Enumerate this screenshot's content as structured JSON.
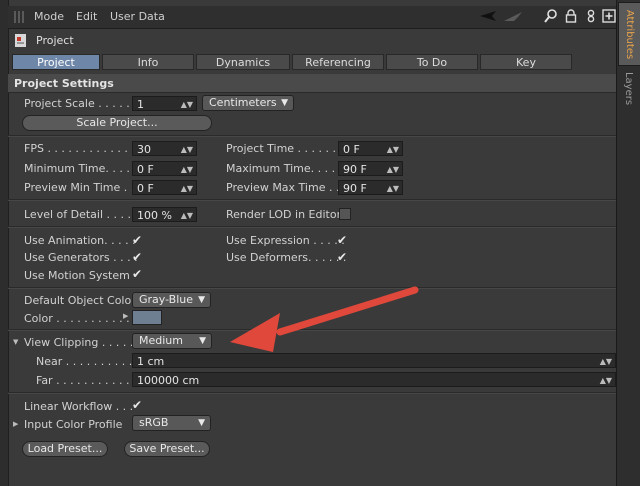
{
  "menu": {
    "items": [
      "Mode",
      "Edit",
      "User Data"
    ]
  },
  "side_tabs": {
    "attributes": "Attributes",
    "layers": "Layers"
  },
  "header": {
    "title": "Project"
  },
  "tabs": [
    "Project Settings",
    "Info",
    "Dynamics",
    "Referencing",
    "To Do",
    "Key Interpolation"
  ],
  "section": {
    "title": "Project Settings"
  },
  "fields": {
    "project_scale": {
      "label": "Project Scale . . . . . .",
      "value": "1",
      "unit": "Centimeters"
    },
    "scale_project_button": "Scale Project...",
    "fps": {
      "label": "FPS . . . . . . . . . . . . . . .",
      "value": "30"
    },
    "project_time": {
      "label": "Project Time . . . . . . . .",
      "value": "0 F"
    },
    "minimum_time": {
      "label": "Minimum Time. . . . . . .",
      "value": "0 F"
    },
    "maximum_time": {
      "label": "Maximum Time. . . . . . .",
      "value": "90 F"
    },
    "preview_min_time": {
      "label": "Preview Min Time . .",
      "value": "0 F"
    },
    "preview_max_time": {
      "label": "Preview Max Time . . .",
      "value": "90 F"
    },
    "level_of_detail": {
      "label": "Level of Detail . . . . .",
      "value": "100 %"
    },
    "render_lod": {
      "label": "Render LOD in Editor",
      "checked": false
    },
    "use_animation": {
      "label": "Use Animation. . . . .",
      "checked": true
    },
    "use_expression": {
      "label": "Use Expression . . . . .",
      "checked": true
    },
    "use_generators": {
      "label": "Use Generators . . . .",
      "checked": true
    },
    "use_deformers": {
      "label": "Use Deformers. . . . . .",
      "checked": true
    },
    "use_motion_system": {
      "label": "Use Motion System",
      "checked": true
    },
    "default_object_color": {
      "label": "Default Object Color",
      "value": "Gray-Blue"
    },
    "color": {
      "label": "Color . . . . . . . . . . .",
      "swatch": "#6f7f92"
    },
    "view_clipping": {
      "label": "View Clipping . . . . .",
      "value": "Medium"
    },
    "near": {
      "label": "Near . . . . . . . . . . . .",
      "value": "1 cm"
    },
    "far": {
      "label": "Far . . . . . . . . . . . . .",
      "value": "100000 cm"
    },
    "linear_workflow": {
      "label": "Linear Workflow . . .",
      "checked": true
    },
    "input_color_profile": {
      "label": "Input Color Profile",
      "value": "sRGB"
    }
  },
  "buttons": {
    "load_preset": "Load Preset...",
    "save_preset": "Save Preset..."
  },
  "colors": {
    "accent_tab": "#6e86a8",
    "arrow": "#e0483b",
    "attributes_tab_text": "#e8a24a"
  },
  "icons": [
    "arrow-left-icon",
    "arrow-up-icon",
    "search-icon",
    "lock-icon",
    "link-icon",
    "new-panel-icon"
  ]
}
